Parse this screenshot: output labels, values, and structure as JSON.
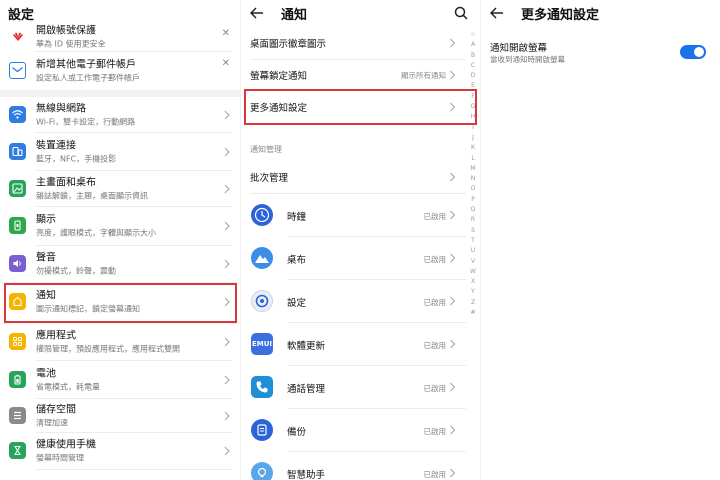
{
  "settings": {
    "title": "設定",
    "rows": [
      {
        "name": "huawei-account",
        "icon": "huawei-logo-icon",
        "label": "開啟帳號保護",
        "sub": "華為 ID 使用更安全",
        "action": "close"
      },
      {
        "name": "add-email",
        "icon": "mail-icon",
        "label": "新增其他電子郵件帳戶",
        "sub": "設定私人或工作電子郵件帳戶",
        "action": "close"
      },
      {
        "name": "wireless",
        "icon": "wifi-icon",
        "label": "無線與網路",
        "sub": "Wi-Fi，雙卡設定，行動網路",
        "action": "chevron"
      },
      {
        "name": "device-connect",
        "icon": "device-connect-icon",
        "label": "裝置連接",
        "sub": "藍牙，NFC，手機投影",
        "action": "chevron"
      },
      {
        "name": "home-wallpaper",
        "icon": "wallpaper-icon",
        "label": "主畫面和桌布",
        "sub": "雜誌解鎖，主題，桌面顯示資訊",
        "action": "chevron"
      },
      {
        "name": "display",
        "icon": "display-icon",
        "label": "顯示",
        "sub": "亮度，護眼模式，字體與顯示大小",
        "action": "chevron"
      },
      {
        "name": "sound",
        "icon": "speaker-icon",
        "label": "聲音",
        "sub": "勿擾模式，鈴聲，震動",
        "action": "chevron"
      },
      {
        "name": "notifications",
        "icon": "bell-icon",
        "label": "通知",
        "sub": "圖示通知標記，鎖定螢幕通知",
        "action": "chevron"
      },
      {
        "name": "apps",
        "icon": "apps-grid-icon",
        "label": "應用程式",
        "sub": "權限管理，預設應用程式，應用程式雙開",
        "action": "chevron"
      },
      {
        "name": "battery",
        "icon": "battery-icon",
        "label": "電池",
        "sub": "省電模式，耗電量",
        "action": "chevron"
      },
      {
        "name": "storage",
        "icon": "storage-icon",
        "label": "儲存空間",
        "sub": "清理加速",
        "action": "chevron"
      },
      {
        "name": "digital-balance",
        "icon": "hourglass-icon",
        "label": "健康使用手機",
        "sub": "螢幕時間管理",
        "action": "chevron"
      }
    ]
  },
  "notifications": {
    "title": "通知",
    "rows": [
      {
        "label": "桌面圖示徽章圖示",
        "value": ""
      },
      {
        "label": "螢幕鎖定通知",
        "value": "顯示所有通知"
      },
      {
        "label": "更多通知設定",
        "value": ""
      }
    ],
    "section_label": "通知管理",
    "batch_label": "批次管理",
    "apps": [
      {
        "name": "clock",
        "icon": "clock-icon",
        "label": "時鐘",
        "status": "已啟用"
      },
      {
        "name": "wallpaper",
        "icon": "mountain-icon",
        "label": "桌布",
        "status": "已啟用"
      },
      {
        "name": "settings",
        "icon": "gear-icon",
        "label": "設定",
        "status": "已啟用"
      },
      {
        "name": "software-update",
        "icon": "emui-icon",
        "label": "軟體更新",
        "status": "已啟用",
        "badge": "EMUI"
      },
      {
        "name": "call-management",
        "icon": "phone-icon",
        "label": "通話管理",
        "status": "已啟用"
      },
      {
        "name": "backup",
        "icon": "backup-icon",
        "label": "備份",
        "status": "已啟用"
      },
      {
        "name": "smart-assistant",
        "icon": "lightbulb-icon",
        "label": "智慧助手",
        "status": "已啟用"
      }
    ],
    "alphabet": [
      "☆",
      "A",
      "B",
      "C",
      "D",
      "E",
      "F",
      "G",
      "H",
      "I",
      "J",
      "K",
      "L",
      "M",
      "N",
      "O",
      "P",
      "Q",
      "R",
      "S",
      "T",
      "U",
      "V",
      "W",
      "X",
      "Y",
      "Z",
      "#"
    ]
  },
  "more_notifications": {
    "title": "更多通知設定",
    "toggle_label": "通知開啟螢幕",
    "toggle_sub": "當收到通知時開啟螢幕",
    "toggle_on": true,
    "accent": "#1a73e8"
  },
  "colors": {
    "highlight": "#d9363e",
    "wifi": "#2f7de1",
    "device": "#2f7de1",
    "wallpaper": "#27a35a",
    "display": "#2aa84a",
    "sound": "#7a5fd3",
    "bell": "#f5b400",
    "apps": "#f5b400",
    "battery": "#27a35a",
    "storage": "#8a8a8a",
    "hourglass": "#27a35a"
  }
}
